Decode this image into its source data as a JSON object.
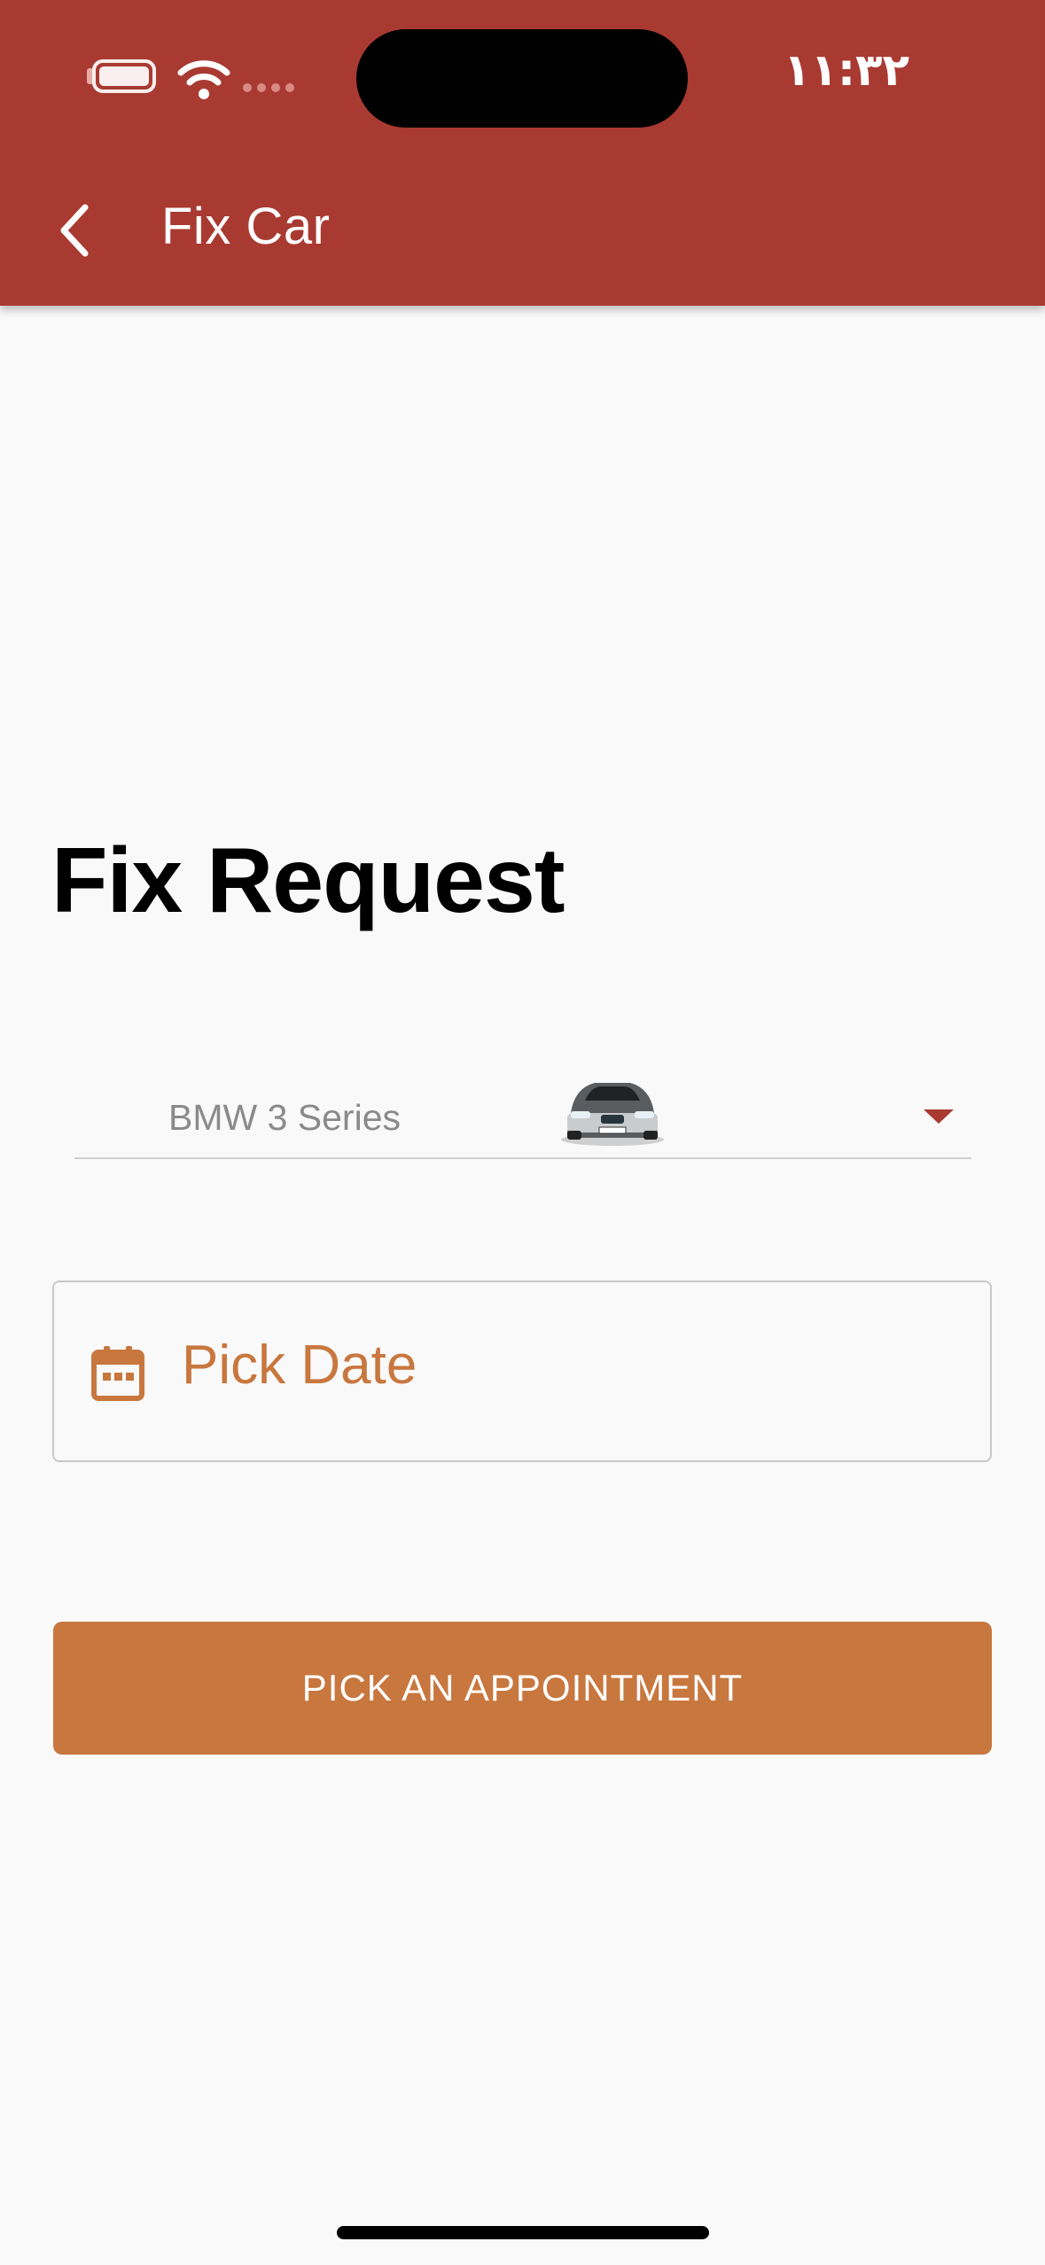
{
  "status_bar": {
    "time": "١١:٣٢",
    "icons": [
      "battery-icon",
      "wifi-icon",
      "signal-icon"
    ]
  },
  "app_bar": {
    "title": "Fix Car",
    "back_icon": "chevron-left-icon",
    "color": "#a93a32"
  },
  "form": {
    "heading": "Fix Request",
    "car_select": {
      "selected": "BMW 3 Series",
      "image": "car-thumbnail",
      "arrow_icon": "dropdown-arrow-icon"
    },
    "date_field": {
      "placeholder": "Pick Date",
      "icon": "calendar-icon"
    },
    "submit_label": "PICK AN APPOINTMENT"
  },
  "colors": {
    "primary": "#a93a32",
    "accent": "#c8773e",
    "background": "#f9f9f9"
  }
}
